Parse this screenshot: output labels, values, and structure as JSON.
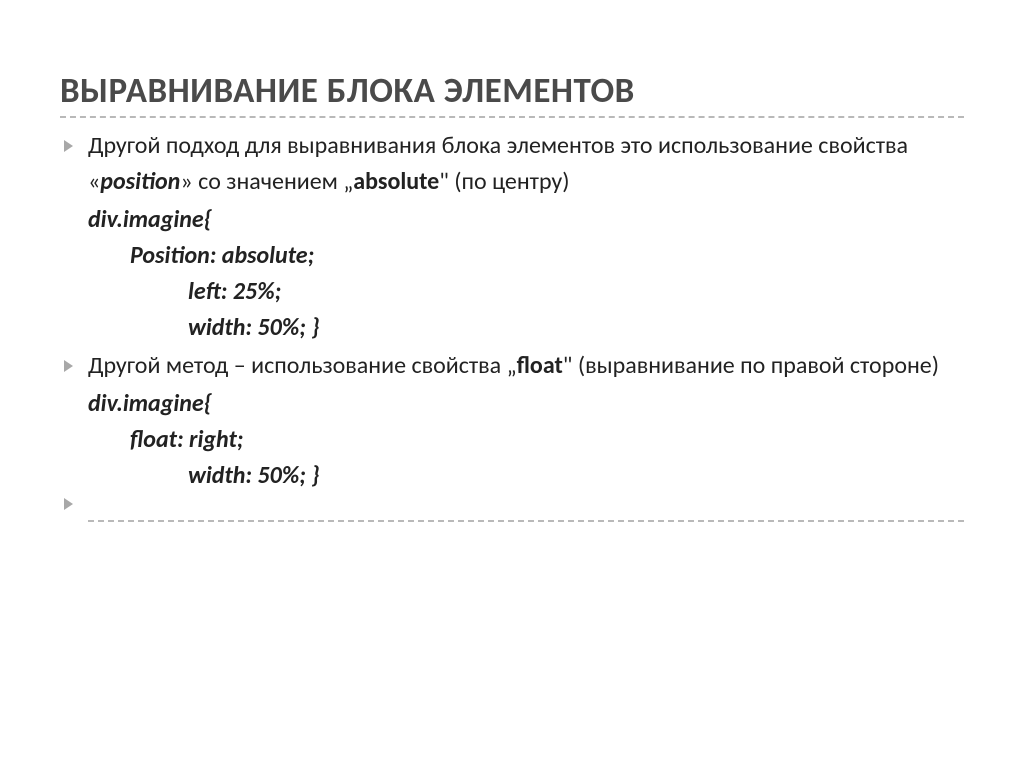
{
  "title": "ВЫРАВНИВАНИЕ БЛОКА ЭЛЕМЕНТОВ",
  "para1": {
    "pre": "Другой подход для выравнивания блока элементов это использование свойства «",
    "prop": "position",
    "mid": "» со значением „",
    "val": "absolute",
    "post": "\" (по центру)"
  },
  "code1": {
    "l1": "div.imagine{",
    "l2": "Position: absolute;",
    "l3": "left: 25%;",
    "l4": "width: 50%;   }"
  },
  "para2": {
    "pre": "Другой метод – использование свойства „",
    "val": "float",
    "post": "\" (выравнивание по правой стороне)"
  },
  "code2": {
    "l1": "div.imagine{",
    "l2": "float: right;",
    "l3": "width: 50%;   }"
  }
}
